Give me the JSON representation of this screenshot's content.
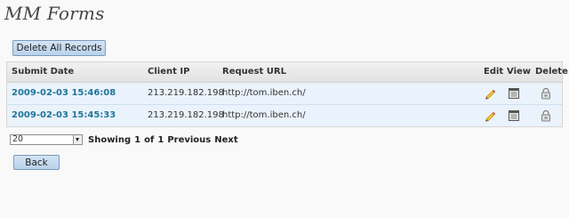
{
  "title": "MM Forms",
  "toolbar": {
    "delete_all_label": "Delete All Records"
  },
  "table": {
    "columns": {
      "submit_date": "Submit Date",
      "client_ip": "Client IP",
      "request_url": "Request URL",
      "edit": "Edit",
      "view": "View",
      "delete": "Delete"
    },
    "rows": [
      {
        "submit_date": "2009-02-03 15:46:08",
        "client_ip": "213.219.182.198",
        "request_url": "http://tom.iben.ch/"
      },
      {
        "submit_date": "2009-02-03 15:45:33",
        "client_ip": "213.219.182.198",
        "request_url": "http://tom.iben.ch/"
      }
    ]
  },
  "pager": {
    "per_page": "20",
    "showing": "Showing",
    "current": "1",
    "of": "of",
    "total": "1",
    "previous": "Previous",
    "next": "Next"
  },
  "footer": {
    "back_label": "Back"
  },
  "icons": {
    "edit": "pencil-icon",
    "view": "document-view-icon",
    "delete": "lock-delete-icon"
  },
  "colors": {
    "link": "#21759b",
    "row_bg": "#eaf3fb",
    "button_bg": "#c6dcf0"
  }
}
